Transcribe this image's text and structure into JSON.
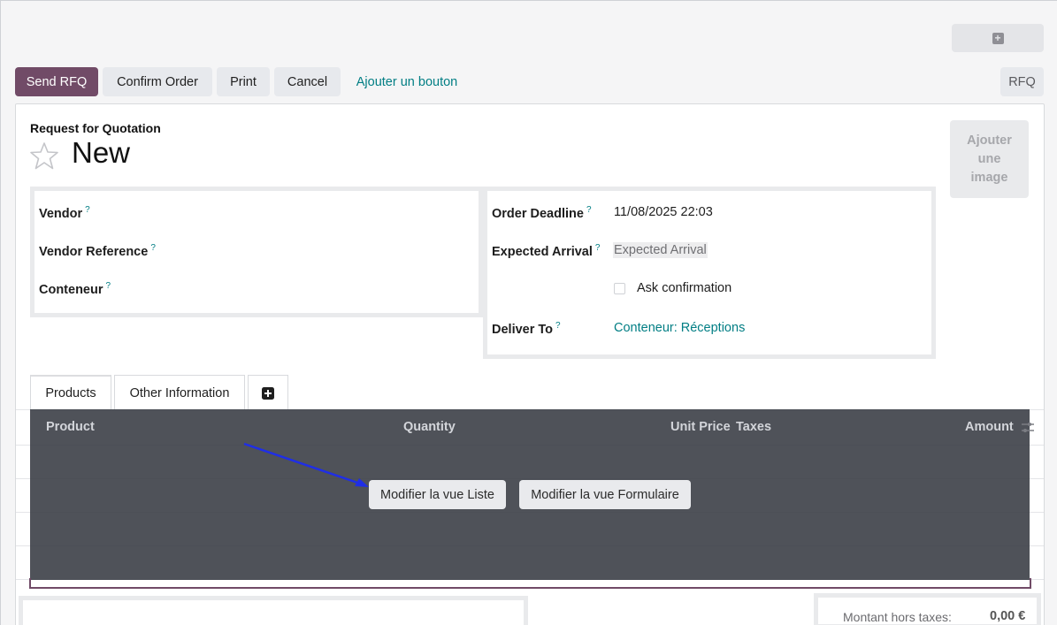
{
  "topbar": {
    "add_icon": "plus-square-icon"
  },
  "control_panel": {
    "send_rfq": "Send RFQ",
    "confirm_order": "Confirm Order",
    "print": "Print",
    "cancel": "Cancel",
    "add_button": "Ajouter un bouton",
    "status": "RFQ"
  },
  "form": {
    "type_label": "Request for Quotation",
    "title": "New",
    "star_icon": "star-outline-icon",
    "image_placeholder": [
      "Ajouter",
      "une",
      "image"
    ],
    "left_fields": [
      {
        "label": "Vendor",
        "help": "?"
      },
      {
        "label": "Vendor Reference",
        "help": "?"
      },
      {
        "label": "Conteneur",
        "help": "?"
      }
    ],
    "right_fields": {
      "order_deadline": {
        "label": "Order Deadline",
        "help": "?",
        "value": "11/08/2025 22:03"
      },
      "expected_arrival": {
        "label": "Expected Arrival",
        "help": "?",
        "placeholder": "Expected Arrival"
      },
      "ask_confirmation": {
        "label": "Ask confirmation",
        "checked": false
      },
      "deliver_to": {
        "label": "Deliver To",
        "help": "?",
        "value": "Conteneur: Réceptions"
      }
    }
  },
  "tabs": [
    {
      "label": "Products",
      "active": true
    },
    {
      "label": "Other Information",
      "active": false
    },
    {
      "icon": "plus-square-icon"
    }
  ],
  "list": {
    "columns": [
      "Product",
      "Quantity",
      "Unit Price",
      "Taxes",
      "Amount"
    ],
    "settings_icon": "sliders-icon",
    "overlay_buttons": {
      "edit_list": "Modifier la vue Liste",
      "edit_form": "Modifier la vue Formulaire"
    },
    "arrow_color": "#1f2ee6"
  },
  "totals": {
    "untaxed_label": "Montant hors taxes:",
    "untaxed_value": "0,00 €"
  },
  "colors": {
    "primary": "#714b67",
    "link": "#017e84"
  }
}
